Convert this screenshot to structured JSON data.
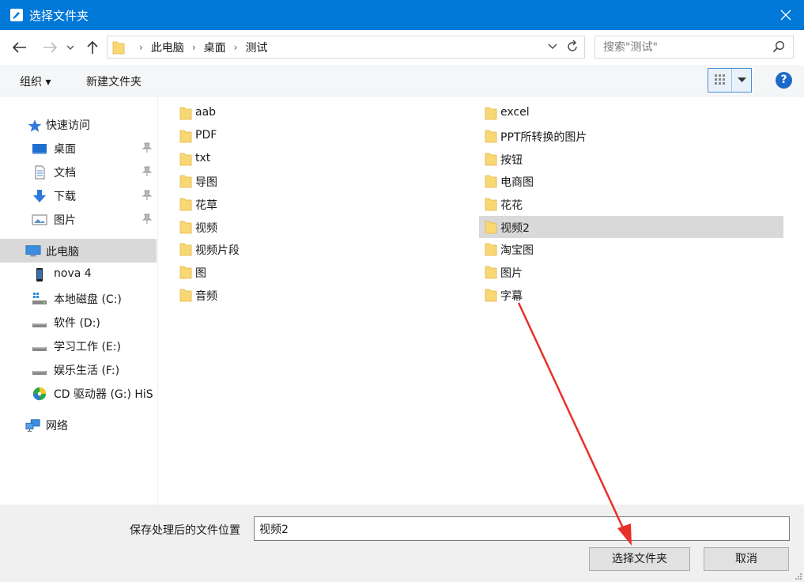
{
  "window": {
    "title": "选择文件夹",
    "close_icon": "close-icon"
  },
  "nav": {
    "breadcrumbs": [
      "此电脑",
      "桌面",
      "测试"
    ],
    "search_placeholder": "搜索\"测试\""
  },
  "toolbar": {
    "organize_label": "组织 ▾",
    "new_folder_label": "新建文件夹",
    "help_label": "?"
  },
  "sidebar": {
    "quick_access": "快速访问",
    "items": [
      {
        "label": "桌面",
        "icon": "desktop-icon",
        "pinned": true
      },
      {
        "label": "文档",
        "icon": "document-icon",
        "pinned": true
      },
      {
        "label": "下载",
        "icon": "download-icon",
        "pinned": true
      },
      {
        "label": "图片",
        "icon": "pictures-icon",
        "pinned": true
      }
    ],
    "this_pc": "此电脑",
    "drives": [
      {
        "label": "nova 4",
        "icon": "phone-icon"
      },
      {
        "label": "本地磁盘 (C:)",
        "icon": "system-drive-icon"
      },
      {
        "label": "软件 (D:)",
        "icon": "drive-icon"
      },
      {
        "label": "学习工作 (E:)",
        "icon": "drive-icon"
      },
      {
        "label": "娱乐生活 (F:)",
        "icon": "drive-icon"
      },
      {
        "label": "CD 驱动器 (G:) HiS",
        "icon": "cd-drive-icon"
      }
    ],
    "network": "网络"
  },
  "files": {
    "left": [
      "aab",
      "PDF",
      "txt",
      "导图",
      "花草",
      "视频",
      "视频片段",
      "图",
      "音频"
    ],
    "right": [
      "excel",
      "PPT所转换的图片",
      "按钮",
      "电商图",
      "花花",
      "视频2",
      "淘宝图",
      "图片",
      "字幕"
    ],
    "selected": "视频2"
  },
  "footer": {
    "path_label": "保存处理后的文件位置",
    "path_value": "视频2",
    "select_button": "选择文件夹",
    "cancel_button": "取消"
  },
  "colors": {
    "titlebar": "#0078d7",
    "folder": "#f8d775",
    "selection": "#d9d9d9",
    "annotation_arrow": "#e8302a"
  }
}
